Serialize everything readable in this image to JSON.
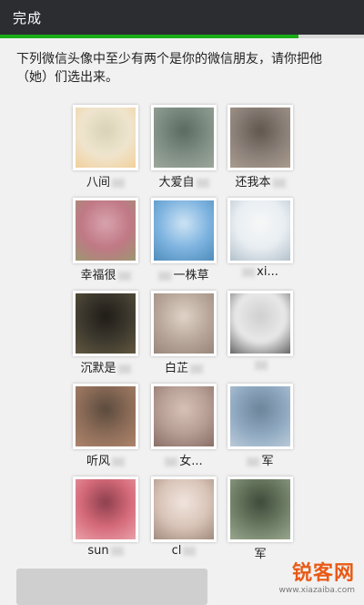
{
  "header": {
    "done_label": "完成"
  },
  "progress": {
    "fraction": 0.82,
    "color": "#1aad19"
  },
  "prompt": {
    "text": "下列微信头像中至少有两个是你的微信朋友，请你把他（她）们选出来。"
  },
  "friends": [
    {
      "name": "八间",
      "trail": true,
      "lead": false
    },
    {
      "name": "大爱自",
      "trail": true,
      "lead": false
    },
    {
      "name": "还我本",
      "trail": true,
      "lead": false
    },
    {
      "name": "幸福很",
      "trail": true,
      "lead": false
    },
    {
      "name": "一株草",
      "trail": false,
      "lead": true
    },
    {
      "name": "xi...",
      "trail": false,
      "lead": true
    },
    {
      "name": "沉默是",
      "trail": true,
      "lead": false
    },
    {
      "name": "白芷",
      "trail": true,
      "lead": false
    },
    {
      "name": "",
      "trail": true,
      "lead": false
    },
    {
      "name": "听风",
      "trail": true,
      "lead": false
    },
    {
      "name": "女...",
      "trail": false,
      "lead": true
    },
    {
      "name": "军",
      "trail": false,
      "lead": true
    },
    {
      "name": "sun",
      "trail": true,
      "lead": false
    },
    {
      "name": "cl",
      "trail": true,
      "lead": false
    },
    {
      "name": "军",
      "trail": false,
      "lead": false
    }
  ],
  "avatar_colors": [
    [
      "#efe5cf",
      "#f3c98a",
      "#d9d2b6"
    ],
    [
      "#7f8e84",
      "#a7b0a3",
      "#5a6a5f"
    ],
    [
      "#8a7f78",
      "#b4a596",
      "#5f564e"
    ],
    [
      "#c07885",
      "#8fa26a",
      "#d8a4ae"
    ],
    [
      "#7fb4e0",
      "#3f7fae",
      "#cfe4f4"
    ],
    [
      "#e8eef2",
      "#a2b2be",
      "#f7f7f7"
    ],
    [
      "#3e3a2f",
      "#6e6144",
      "#1f1c17"
    ],
    [
      "#b8a79a",
      "#8c7b6e",
      "#e0d4c8"
    ],
    [
      "#e9e9e9",
      "#3b3b3b",
      "#cfcfcf"
    ],
    [
      "#8c6c58",
      "#b88c72",
      "#5b4a3d"
    ],
    [
      "#b59d93",
      "#7b5e57",
      "#d7c2b6"
    ],
    [
      "#8ea8c0",
      "#c9d6e0",
      "#6c8499"
    ],
    [
      "#d56a7a",
      "#f0b2b8",
      "#8c3f4c"
    ],
    [
      "#d9c4b8",
      "#8f776b",
      "#f0e5de"
    ],
    [
      "#6c7b63",
      "#a8b59d",
      "#3e4a39"
    ]
  ],
  "watermark": {
    "main": "锐客网",
    "url": "www.xiazaiba.com"
  }
}
